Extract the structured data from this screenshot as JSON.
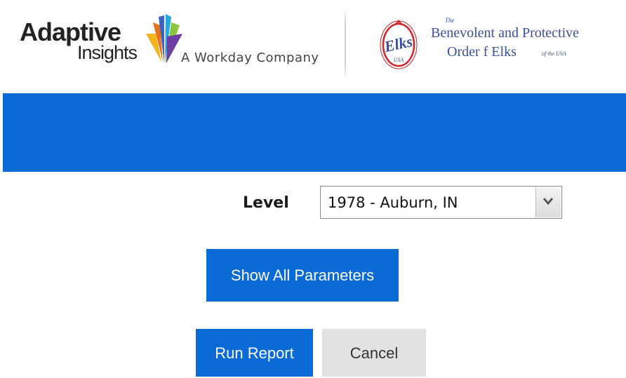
{
  "header": {
    "adaptive_logo": {
      "word1": "Adaptive",
      "word2": "Insights",
      "tagline": "A Workday Company"
    },
    "elks_logo": {
      "emblem_text": "Elks",
      "emblem_subtext": "USA",
      "the": "The",
      "line1": "Benevolent and Protective",
      "line2": "Order f Elks",
      "usa": "of the USA"
    }
  },
  "colors": {
    "brand_blue": "#0a6ad6",
    "cancel_gray": "#e2e2e2",
    "elks_blue": "#3b4fa0",
    "elks_red": "#d2232a"
  },
  "form": {
    "level_label": "Level",
    "level_value": "1978 - Auburn, IN"
  },
  "buttons": {
    "show_all": "Show All Parameters",
    "run_report": "Run Report",
    "cancel": "Cancel"
  }
}
